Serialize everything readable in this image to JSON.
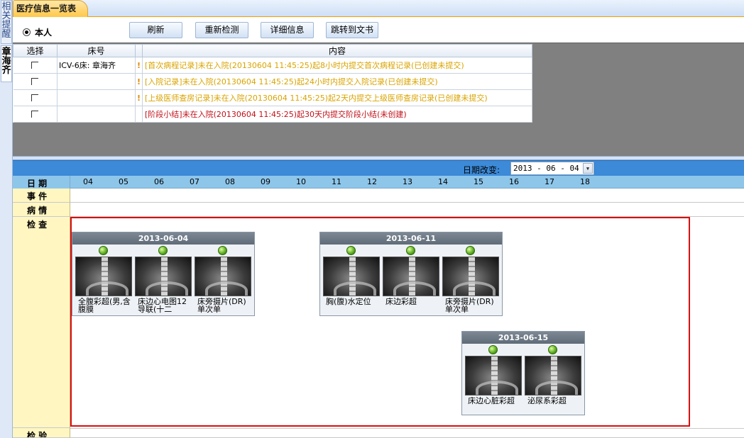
{
  "left_tabs": [
    {
      "label": "相关提醒",
      "active": false
    },
    {
      "label": "章海齐",
      "active": true
    }
  ],
  "tab": {
    "title": "医疗信息一览表"
  },
  "toolbar": {
    "self_label": "本人",
    "refresh": "刷新",
    "recheck": "重新检测",
    "details": "详细信息",
    "jump": "跳转到文书"
  },
  "reminders": {
    "headers": {
      "select": "选择",
      "bed": "床号",
      "content": "内容"
    },
    "rows": [
      {
        "bed": "ICV-6床: 章海齐",
        "flag": "!",
        "content": "[首次病程记录]未在入院(20130604  11:45:25)起8小时内提交首次病程记录(已创建未提交)",
        "color": "#d9a400"
      },
      {
        "bed": "",
        "flag": "!",
        "content": "[入院记录]未在入院(20130604  11:45:25)起24小时内提交入院记录(已创建未提交)",
        "color": "#d9a400"
      },
      {
        "bed": "",
        "flag": "!",
        "content": "[上级医师查房记录]未在入院(20130604  11:45:25)起2天内提交上级医师查房记录(已创建未提交)",
        "color": "#d9a400"
      },
      {
        "bed": "",
        "flag": "",
        "content": "[阶段小结]未在入院(20130604  11:45:25)起30天内提交阶段小结(未创建)",
        "color": "#c0101a"
      }
    ]
  },
  "timeline": {
    "date_change_label": "日期改变:",
    "date_value": "2013 - 06 - 04",
    "row_labels": {
      "date": "日  期",
      "event": "事  件",
      "condition": "病  情",
      "exam": "检  查",
      "test": "检  验"
    },
    "days": [
      "04",
      "05",
      "06",
      "07",
      "08",
      "09",
      "10",
      "11",
      "12",
      "13",
      "14",
      "15",
      "16",
      "17",
      "18"
    ]
  },
  "exam_groups": [
    {
      "date": "2013-06-04",
      "items": [
        "全腹彩超(男,含腹膜",
        "床边心电图12导联(十二",
        "床旁摄片(DR)单次单"
      ]
    },
    {
      "date": "2013-06-11",
      "items": [
        "胸(腹)水定位",
        "床边彩超",
        "床旁摄片(DR)单次单"
      ]
    },
    {
      "date": "2013-06-15",
      "items": [
        "床边心脏彩超",
        "泌尿系彩超"
      ]
    }
  ],
  "colors": {
    "accent_tab": "#ffc84a",
    "header_blue": "#3c8ad8",
    "timeline_blue": "#8ec6ea",
    "highlight_red": "#d81010",
    "status_green": "#5aa81e"
  }
}
